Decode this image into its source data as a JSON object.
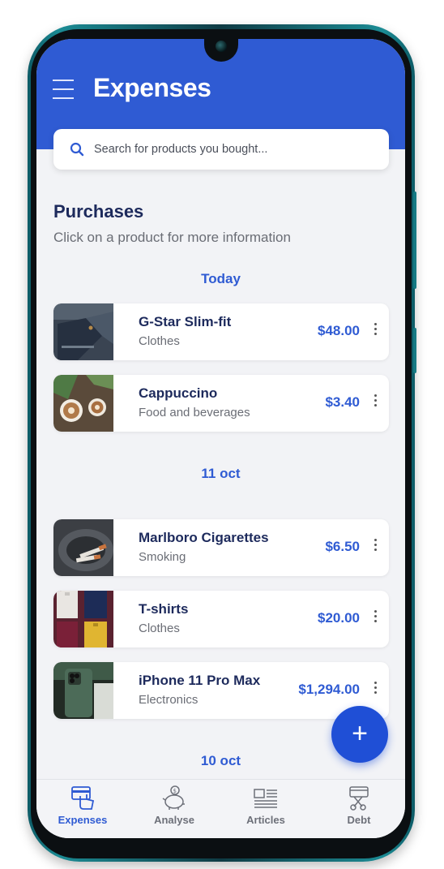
{
  "app": {
    "title": "Expenses"
  },
  "search": {
    "placeholder": "Search for products you bought..."
  },
  "purchases": {
    "title": "Purchases",
    "subtitle": "Click on a product for more information"
  },
  "groups": [
    {
      "date": "Today",
      "items": [
        {
          "name": "G-Star Slim-fit",
          "category": "Clothes",
          "price": "$48.00"
        },
        {
          "name": "Cappuccino",
          "category": "Food and beverages",
          "price": "$3.40"
        }
      ]
    },
    {
      "date": "11 oct",
      "items": [
        {
          "name": "Marlboro Cigarettes",
          "category": "Smoking",
          "price": "$6.50"
        },
        {
          "name": "T-shirts",
          "category": "Clothes",
          "price": "$20.00"
        },
        {
          "name": "iPhone 11 Pro Max",
          "category": "Electronics",
          "price": "$1,294.00"
        }
      ]
    },
    {
      "date": "10 oct",
      "items": []
    }
  ],
  "fab": {
    "label": "+"
  },
  "nav": [
    {
      "label": "Expenses",
      "icon": "expenses-icon",
      "active": true
    },
    {
      "label": "Analyse",
      "icon": "piggy-bank-icon",
      "active": false
    },
    {
      "label": "Articles",
      "icon": "articles-icon",
      "active": false
    },
    {
      "label": "Debt",
      "icon": "debt-icon",
      "active": false
    }
  ],
  "colors": {
    "accent": "#2f5bd3",
    "header": "#2f5bd3",
    "text_dark": "#1d2a5c",
    "text_muted": "#6a6d75"
  }
}
